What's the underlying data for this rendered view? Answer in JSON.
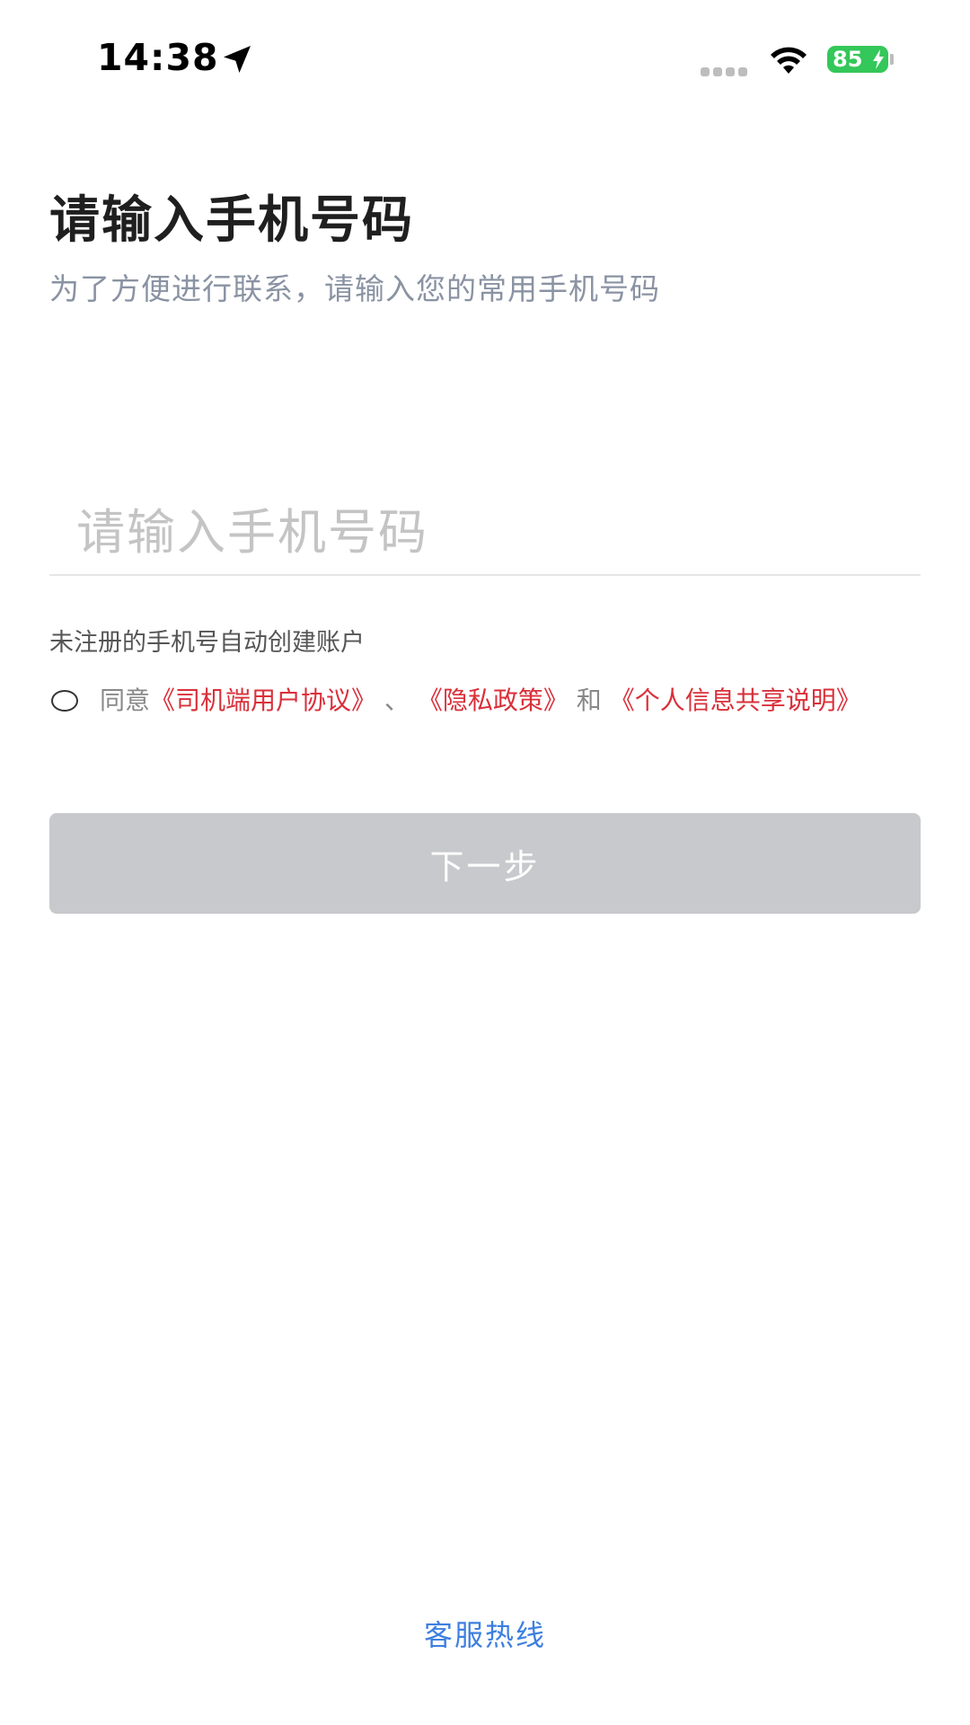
{
  "status_bar": {
    "time": "14:38",
    "battery_level": "85",
    "icons": [
      "location-arrow-icon",
      "signal-icon",
      "wifi-icon",
      "battery-charging-icon"
    ]
  },
  "header": {
    "title": "请输入手机号码",
    "subtitle": "为了方便进行联系，请输入您的常用手机号码"
  },
  "phone_input": {
    "value": "",
    "placeholder": "请输入手机号码"
  },
  "register_hint": "未注册的手机号自动创建账户",
  "agreement": {
    "checked": false,
    "prefix": "同意",
    "driver_agreement": "《司机端用户协议》",
    "separator": "、",
    "privacy_policy": "《隐私政策》",
    "and": "和",
    "info_sharing": "《个人信息共享说明》"
  },
  "next_button": {
    "label": "下一步",
    "enabled": false
  },
  "hotline": {
    "label": "客服热线"
  },
  "colors": {
    "link": "#d9303a",
    "button_disabled": "#c8c9cc",
    "hotline": "#3d7fe0",
    "battery": "#34c759"
  }
}
